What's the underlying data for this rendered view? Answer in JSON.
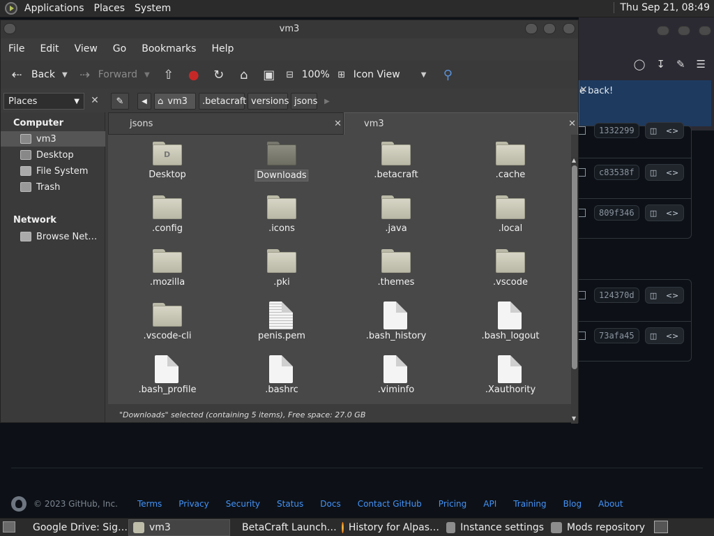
{
  "top_panel": {
    "menus": [
      "Applications",
      "Places",
      "System"
    ],
    "clock": "Thu Sep 21, 08:49"
  },
  "browser": {
    "notice_text": "e back!",
    "commits": [
      "1332299",
      "c83538f",
      "809f346",
      "124370d",
      "73afa45"
    ]
  },
  "footer": {
    "copyright": "© 2023 GitHub, Inc.",
    "links": [
      "Terms",
      "Privacy",
      "Security",
      "Status",
      "Docs",
      "Contact GitHub",
      "Pricing",
      "API",
      "Training",
      "Blog",
      "About"
    ]
  },
  "file_manager": {
    "title": "vm3",
    "menus": [
      "File",
      "Edit",
      "View",
      "Go",
      "Bookmarks",
      "Help"
    ],
    "toolbar": {
      "back": "Back",
      "forward": "Forward",
      "zoom": "100%",
      "view_mode": "Icon View"
    },
    "side_pane": "Places",
    "path": [
      "vm3",
      ".betacraft",
      "versions",
      "jsons"
    ],
    "sidebar": {
      "computer_heading": "Computer",
      "computer_items": [
        "vm3",
        "Desktop",
        "File System",
        "Trash"
      ],
      "network_heading": "Network",
      "network_items": [
        "Browse Net…"
      ]
    },
    "tabs": [
      "jsons",
      "vm3"
    ],
    "files": [
      {
        "name": "Desktop",
        "kind": "folder-desktop"
      },
      {
        "name": "Downloads",
        "kind": "folder-selected"
      },
      {
        "name": ".betacraft",
        "kind": "folder"
      },
      {
        "name": ".cache",
        "kind": "folder"
      },
      {
        "name": ".config",
        "kind": "folder"
      },
      {
        "name": ".icons",
        "kind": "folder"
      },
      {
        "name": ".java",
        "kind": "folder"
      },
      {
        "name": ".local",
        "kind": "folder"
      },
      {
        "name": ".mozilla",
        "kind": "folder"
      },
      {
        "name": ".pki",
        "kind": "folder"
      },
      {
        "name": ".themes",
        "kind": "folder"
      },
      {
        "name": ".vscode",
        "kind": "folder"
      },
      {
        "name": ".vscode-cli",
        "kind": "folder"
      },
      {
        "name": "penis.pem",
        "kind": "text"
      },
      {
        "name": ".bash_history",
        "kind": "file"
      },
      {
        "name": ".bash_logout",
        "kind": "file"
      },
      {
        "name": ".bash_profile",
        "kind": "file"
      },
      {
        "name": ".bashrc",
        "kind": "file"
      },
      {
        "name": ".viminfo",
        "kind": "file"
      },
      {
        "name": ".Xauthority",
        "kind": "file"
      }
    ],
    "status": "\"Downloads\" selected (containing 5 items), Free space: 27.0 GB"
  },
  "taskbar": [
    {
      "label": "Google Drive: Sig…",
      "icon": "chrome-icon"
    },
    {
      "label": "vm3",
      "icon": "folder-icon"
    },
    {
      "label": "BetaCraft Launch…",
      "icon": "java-icon"
    },
    {
      "label": "History for Alpas…",
      "icon": "firefox-icon"
    },
    {
      "label": "Instance settings",
      "icon": "java-icon"
    },
    {
      "label": "Mods repository",
      "icon": "java-icon"
    }
  ],
  "colors": {
    "panel": "#2b2b2b",
    "window": "#3c3c3c",
    "icon_view": "#484848",
    "github_bg": "#0d1117",
    "link": "#4493f8",
    "stop_red": "#c62828"
  }
}
